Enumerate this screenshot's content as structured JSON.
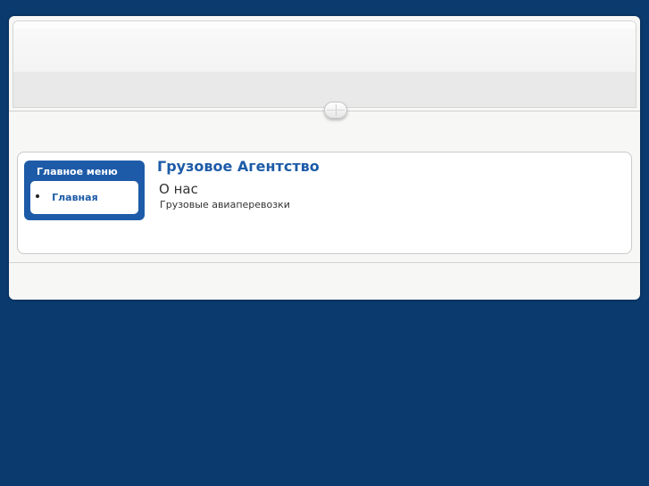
{
  "menu": {
    "title": "Главное меню",
    "items": [
      {
        "label": "Главная"
      }
    ]
  },
  "main": {
    "site_title": "Грузовое Агентство",
    "heading": "О нас",
    "subtext": "Грузовые авиаперевозки"
  },
  "colors": {
    "background": "#0b3a6e",
    "page": "#f7f7f6",
    "accent": "#1d5ba8",
    "text": "#333333"
  }
}
